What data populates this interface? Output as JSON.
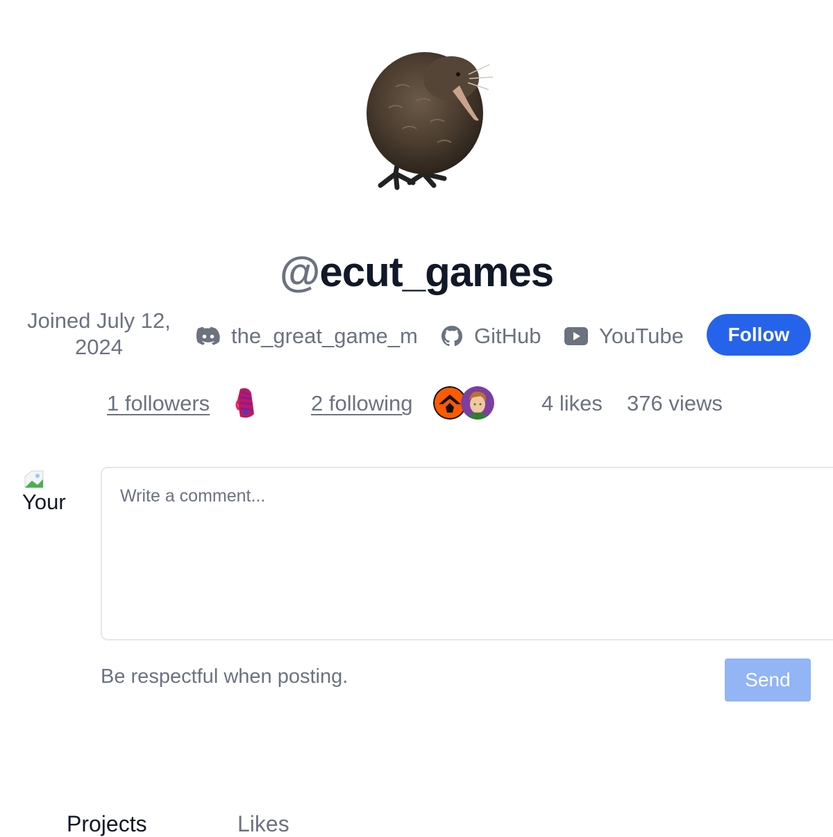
{
  "profile": {
    "at": "@",
    "handle": "ecut_games",
    "joined": "Joined July 12, 2024",
    "avatar_icon": "kiwi-bird-avatar",
    "follow_label": "Follow"
  },
  "links": [
    {
      "icon": "discord-icon",
      "label": "the_great_game_m"
    },
    {
      "icon": "github-icon",
      "label": "GitHub"
    },
    {
      "icon": "youtube-icon",
      "label": "YouTube"
    }
  ],
  "stats": {
    "followers": "1 followers",
    "following": "2 following",
    "likes": "4 likes",
    "views": "376 views"
  },
  "comment": {
    "avatar_alt": "Your",
    "placeholder": "Write a comment...",
    "hint": "Be respectful when posting.",
    "send_label": "Send"
  },
  "tabs": [
    {
      "label": "Projects",
      "active": true
    },
    {
      "label": "Likes",
      "active": false
    }
  ],
  "colors": {
    "accent": "#2563eb",
    "send_disabled": "#93b4f5",
    "title": "#111827",
    "muted": "#6b7280"
  }
}
